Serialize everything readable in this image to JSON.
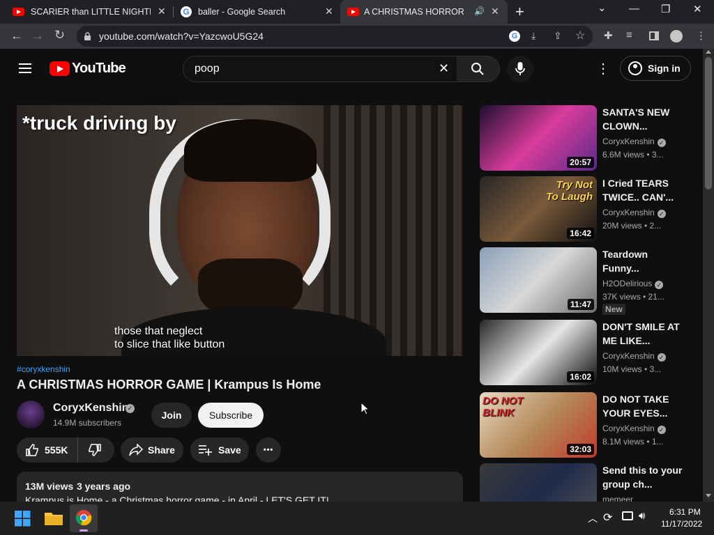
{
  "tabs": [
    {
      "title": "SCARIER than LITTLE NIGHTMARES",
      "favicon": "youtube-favicon"
    },
    {
      "title": "baller - Google Search",
      "favicon": "google-favicon"
    },
    {
      "title": "A CHRISTMAS HORROR GAME",
      "favicon": "youtube-favicon",
      "active": true
    }
  ],
  "tab_close_glyph": "✕",
  "new_tab_glyph": "+",
  "window_controls": {
    "chevron": "⌄",
    "minimize": "—",
    "restore": "❐",
    "close": "✕"
  },
  "toolbar": {
    "back": "←",
    "forward": "→",
    "reload": "↻",
    "url": "youtube.com/watch?v=YazcwoU5G24",
    "lock": "🔒"
  },
  "youtube": {
    "logo_text": "YouTube",
    "search_query": "poop",
    "clear_glyph": "✕",
    "search_glyph": "⌕",
    "more_glyph": "⋮",
    "sign_in": "Sign in"
  },
  "video": {
    "caption_top": "*truck driving by",
    "caption_bottom_1": "those that neglect",
    "caption_bottom_2": "to slice that like button",
    "hashtag": "#coryxkenshin",
    "title": "A CHRISTMAS HORROR GAME | Krampus Is Home",
    "channel": "CoryxKenshin",
    "verified_glyph": "✓",
    "subscribers": "14.9M subscribers",
    "join": "Join",
    "subscribe": "Subscribe",
    "likes": "555K",
    "share": "Share",
    "save": "Save",
    "more": "•••",
    "views": "13M views",
    "age": "3 years ago",
    "description": "Krampus is Home - a Christmas horror game - in April - LET'S GET IT!"
  },
  "recommendations": [
    {
      "title": "SANTA'S NEW CLOWN...",
      "channel": "CoryxKenshin",
      "meta": "6.6M views • 3...",
      "duration": "20:57",
      "colors": [
        "#1c0f2e",
        "#d93c9b",
        "#5a2a8a"
      ]
    },
    {
      "title": "I Cried TEARS TWICE.. CAN'...",
      "channel": "CoryxKenshin",
      "meta": "20M views • 2...",
      "duration": "16:42",
      "overlay": "Try Not To Laugh",
      "colors": [
        "#262626",
        "#7a5a3a",
        "#111111"
      ]
    },
    {
      "title": "Teardown Funny...",
      "channel": "H2ODelirious",
      "meta": "37K views • 21...",
      "duration": "11:47",
      "badge": "New",
      "colors": [
        "#8aa0b8",
        "#d8d8d8",
        "#6d6d6d"
      ]
    },
    {
      "title": "DON'T SMILE AT ME LIKE...",
      "channel": "CoryxKenshin",
      "meta": "10M views • 3...",
      "duration": "16:02",
      "colors": [
        "#2a2a2a",
        "#e6e6e6",
        "#0a0a0a"
      ]
    },
    {
      "title": "DO NOT TAKE YOUR EYES...",
      "channel": "CoryxKenshin",
      "meta": "8.1M views • 1...",
      "duration": "32:03",
      "overlay": "DO NOT BLINK",
      "colors": [
        "#e8d9c4",
        "#b58a5a",
        "#c0392b"
      ]
    },
    {
      "title": "Send this to your group ch...",
      "channel": "memeer",
      "meta": "",
      "duration": "",
      "colors": [
        "#3a3a3a",
        "#1e2a4a",
        "#555555"
      ]
    }
  ],
  "taskbar": {
    "time": "6:31 PM",
    "date": "11/17/2022"
  },
  "accent_colors": {
    "youtube_red": "#ff0000",
    "page_bg": "#0f0f0f",
    "link_blue": "#3ea6ff"
  }
}
